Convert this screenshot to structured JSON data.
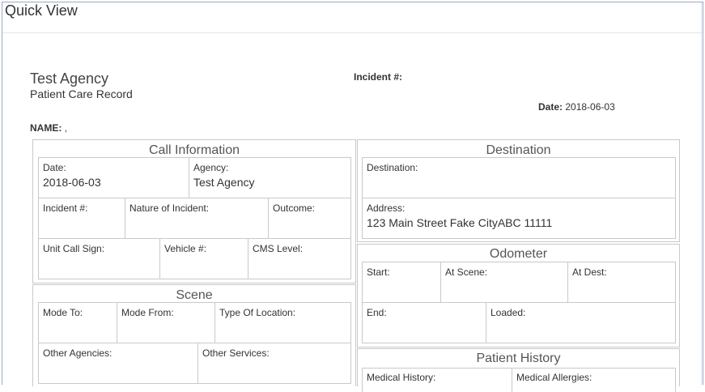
{
  "window": {
    "title": "Quick View"
  },
  "record": {
    "agency_name": "Test Agency",
    "record_title": "Patient Care Record",
    "incident_label": "Incident #:",
    "date_label": "Date:",
    "date_value": "2018-06-03",
    "name_label": "NAME:",
    "name_value": " ,"
  },
  "call_information": {
    "title": "Call Information",
    "date": {
      "label": "Date:",
      "value": "2018-06-03"
    },
    "agency": {
      "label": "Agency:",
      "value": "Test Agency"
    },
    "incident_number": {
      "label": "Incident #:"
    },
    "nature_of_incident": {
      "label": "Nature of Incident:"
    },
    "outcome": {
      "label": "Outcome:"
    },
    "unit_call_sign": {
      "label": "Unit Call Sign:"
    },
    "vehicle_number": {
      "label": "Vehicle #:"
    },
    "cms_level": {
      "label": "CMS Level:"
    }
  },
  "scene": {
    "title": "Scene",
    "mode_to": {
      "label": "Mode To:"
    },
    "mode_from": {
      "label": "Mode From:"
    },
    "type_of_location": {
      "label": "Type Of Location:"
    },
    "other_agencies": {
      "label": "Other Agencies:"
    },
    "other_services": {
      "label": "Other Services:"
    }
  },
  "destination": {
    "title": "Destination",
    "destination": {
      "label": "Destination:"
    },
    "address": {
      "label": "Address:",
      "value": "123 Main Street Fake CityABC 11111"
    }
  },
  "odometer": {
    "title": "Odometer",
    "start": {
      "label": "Start:"
    },
    "at_scene": {
      "label": "At Scene:"
    },
    "at_dest": {
      "label": "At Dest:"
    },
    "end": {
      "label": "End:"
    },
    "loaded": {
      "label": "Loaded:"
    }
  },
  "patient_history": {
    "title": "Patient History",
    "medical_history": {
      "label": "Medical History:"
    },
    "medical_allergies": {
      "label": "Medical Allergies:"
    }
  }
}
